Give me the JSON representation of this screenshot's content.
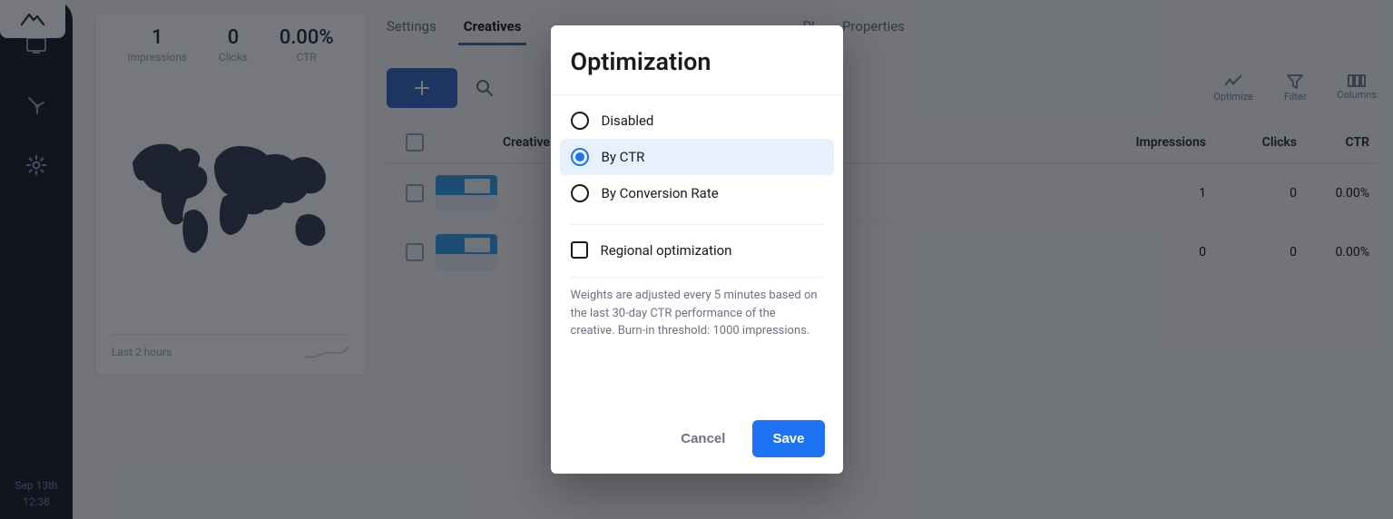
{
  "rail": {
    "date": "Sep 13th",
    "time": "12:38"
  },
  "summary": {
    "stats": [
      {
        "value": "1",
        "label": "Impressions"
      },
      {
        "value": "0",
        "label": "Clicks"
      },
      {
        "value": "0.00%",
        "label": "CTR"
      }
    ],
    "period": "Last 2 hours"
  },
  "tabs": [
    {
      "label": "Settings",
      "active": false
    },
    {
      "label": "Creatives",
      "active": true
    },
    {
      "label": "PI",
      "active": false
    },
    {
      "label": "Properties",
      "active": false
    }
  ],
  "toolbar": {
    "optimize": "Optimize",
    "filter": "Filter",
    "columns": "Columns"
  },
  "table": {
    "headers": {
      "name": "Creative Name",
      "impressions": "Impressions",
      "clicks": "Clicks",
      "ctr": "CTR"
    },
    "rows": [
      {
        "impressions": "1",
        "clicks": "0",
        "ctr": "0.00%"
      },
      {
        "impressions": "0",
        "clicks": "0",
        "ctr": "0.00%"
      }
    ]
  },
  "dialog": {
    "title": "Optimization",
    "options": [
      {
        "label": "Disabled",
        "selected": false
      },
      {
        "label": "By CTR",
        "selected": true
      },
      {
        "label": "By Conversion Rate",
        "selected": false
      }
    ],
    "regional_label": "Regional optimization",
    "help": "Weights are adjusted every 5 minutes based on the last 30-day CTR performance of the creative. Burn-in threshold: 1000 impressions.",
    "cancel": "Cancel",
    "save": "Save"
  }
}
